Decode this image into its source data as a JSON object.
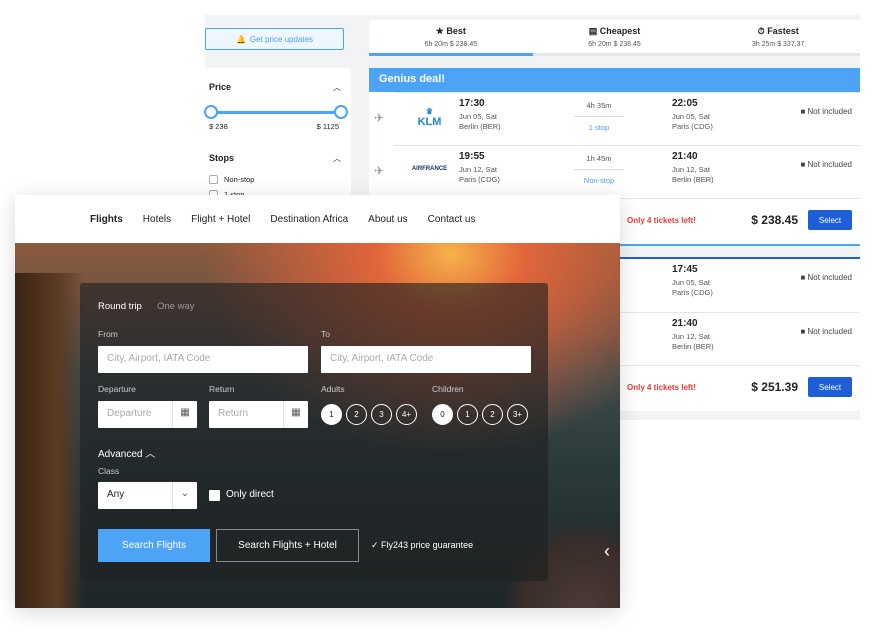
{
  "sidebar": {
    "price_updates_label": "Get price updates",
    "price_title": "Price",
    "price_min": "$ 238",
    "price_max": "$ 1125",
    "price_range_values": [
      238,
      1125
    ],
    "stops_title": "Stops",
    "stops_options": [
      "Non-stop",
      "1 stop"
    ]
  },
  "tabs": [
    {
      "label": "Best",
      "icon": "star-icon",
      "sub": "6h 20m $ 238.45"
    },
    {
      "label": "Cheapest",
      "icon": "wallet-icon",
      "sub": "6h 20m $ 238.45"
    },
    {
      "label": "Fastest",
      "icon": "stopwatch-icon",
      "sub": "3h 25m $ 337.37"
    }
  ],
  "results": [
    {
      "banner": "Genius deal!",
      "legs": [
        {
          "airline": "KLM",
          "dep_time": "17:30",
          "dep_date": "Jun 05, Sat",
          "dep_place": "Berlin (BER)",
          "duration": "4h 35m",
          "stops": "1 stop",
          "arr_time": "22:05",
          "arr_date": "Jun 05, Sat",
          "arr_place": "Paris (CDG)",
          "baggage": "Not included"
        },
        {
          "airline": "AIRFRANCE",
          "dep_time": "19:55",
          "dep_date": "Jun 12, Sat",
          "dep_place": "Paris (CDG)",
          "duration": "1h 45m",
          "stops": "Non-stop",
          "arr_time": "21:40",
          "arr_date": "Jun 12, Sat",
          "arr_place": "Berlin (BER)",
          "baggage": "Not included"
        }
      ],
      "warning": "Only 4 tickets left!",
      "price": "$ 238.45",
      "select": "Select"
    },
    {
      "legs": [
        {
          "arr_time": "17:45",
          "arr_date": "Jun 05, Sat",
          "arr_place": "Paris (CDG)",
          "baggage": "Not included"
        },
        {
          "arr_time": "21:40",
          "arr_date": "Jun 12, Sat",
          "arr_place": "Berlin (BER)",
          "baggage": "Not included"
        }
      ],
      "warning": "Only 4 tickets left!",
      "price": "$ 251.39",
      "select": "Select"
    }
  ],
  "nav": [
    "Flights",
    "Hotels",
    "Flight + Hotel",
    "Destination Africa",
    "About us",
    "Contact us"
  ],
  "form": {
    "trip_round": "Round trip",
    "trip_oneway": "One way",
    "from_label": "From",
    "to_label": "To",
    "from_placeholder": "City, Airport, IATA Code",
    "to_placeholder": "City, Airport, IATA Code",
    "departure_label": "Departure",
    "departure_placeholder": "Departure",
    "return_label": "Return",
    "return_placeholder": "Return",
    "adults_label": "Adults",
    "adults": [
      "1",
      "2",
      "3",
      "4+"
    ],
    "adults_selected": "1",
    "children_label": "Children",
    "children": [
      "0",
      "1",
      "2",
      "3+"
    ],
    "children_selected": "0",
    "advanced": "Advanced",
    "class_label": "Class",
    "class_value": "Any",
    "only_direct": "Only direct",
    "search_flights": "Search Flights",
    "search_hotel": "Search Flights + Hotel",
    "guarantee": "Fly243 price guarantee"
  },
  "colors": {
    "accent": "#4da3f5",
    "select_button": "#1e5fd8",
    "warning": "#e53935"
  }
}
